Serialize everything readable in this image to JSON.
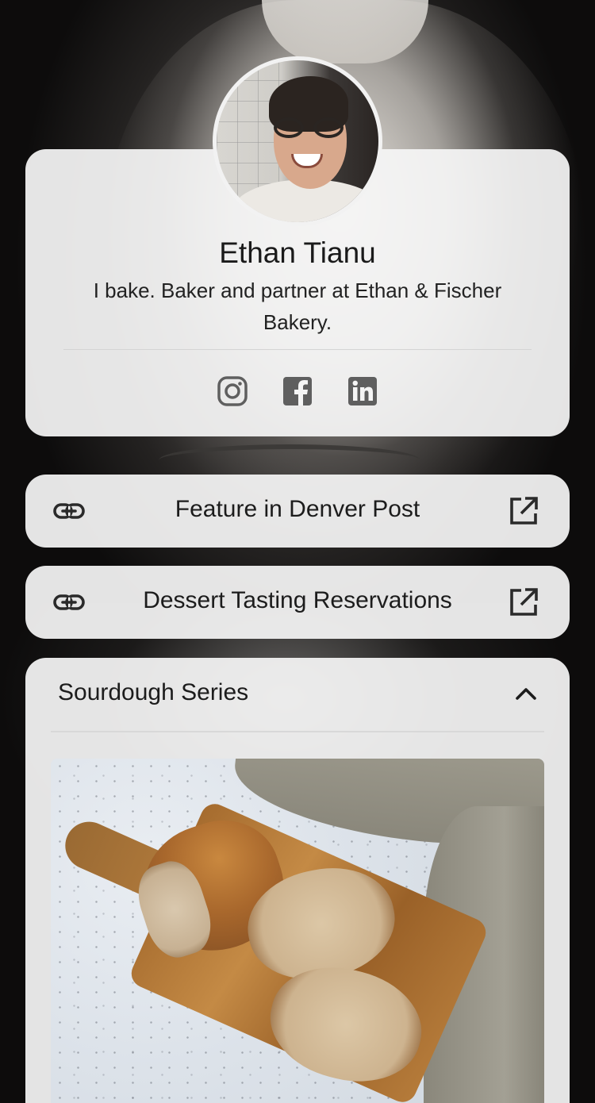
{
  "profile": {
    "name": "Ethan Tianu",
    "bio": "I bake. Baker and partner at Ethan & Fischer Bakery."
  },
  "socials": [
    {
      "icon": "instagram-icon"
    },
    {
      "icon": "facebook-icon"
    },
    {
      "icon": "linkedin-icon"
    }
  ],
  "links": [
    {
      "label": "Feature in Denver Post",
      "icon": "link-icon",
      "action_icon": "external-link-icon"
    },
    {
      "label": "Dessert Tasting Reservations",
      "icon": "link-icon",
      "action_icon": "external-link-icon"
    }
  ],
  "section": {
    "title": "Sourdough Series",
    "state": "expanded",
    "toggle_icon": "chevron-up-icon"
  },
  "colors": {
    "card": "#f5f5f5",
    "text": "#1c1c1c",
    "icon": "#5f5f5f"
  }
}
